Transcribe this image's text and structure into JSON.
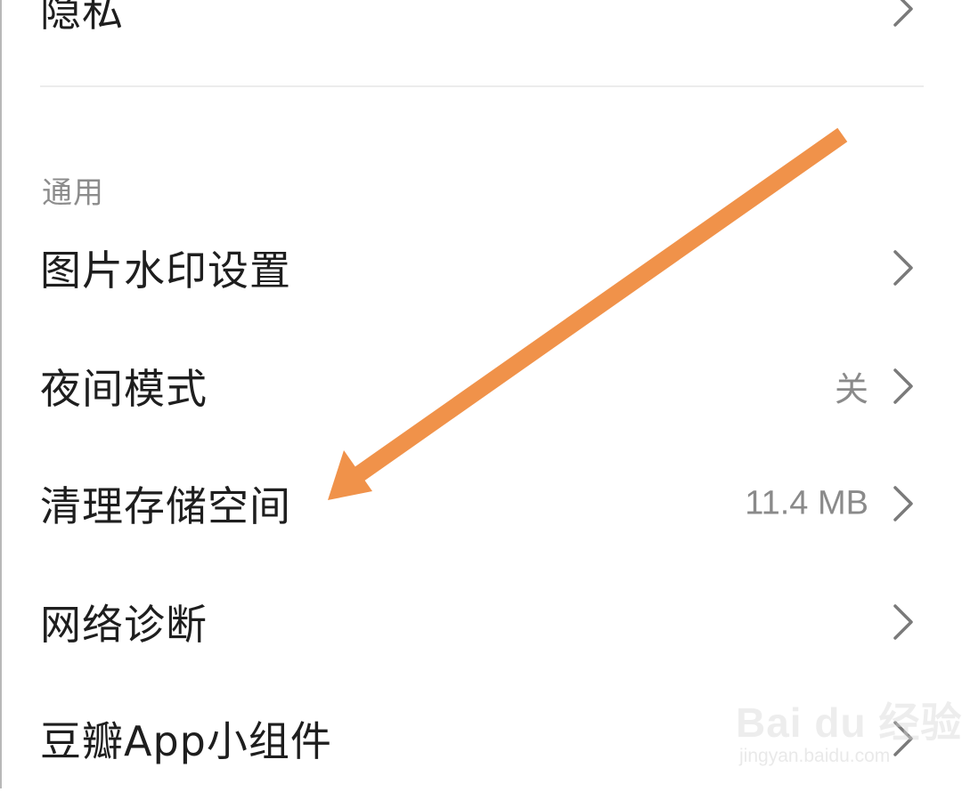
{
  "settings": {
    "rows": [
      {
        "label": "隐私",
        "value": ""
      },
      {
        "label": "图片水印设置",
        "value": ""
      },
      {
        "label": "夜间模式",
        "value": "关"
      },
      {
        "label": "清理存储空间",
        "value": "11.4 MB"
      },
      {
        "label": "网络诊断",
        "value": ""
      },
      {
        "label": "豆瓣App小组件",
        "value": ""
      }
    ],
    "section_general": "通用"
  },
  "annotation": {
    "arrow_color": "#F0924A",
    "target": "清理存储空间"
  },
  "watermark": {
    "brand": "Bai du 经验",
    "url": "jingyan.baidu.com"
  },
  "icons": {
    "chevron": "chevron-right-icon"
  }
}
